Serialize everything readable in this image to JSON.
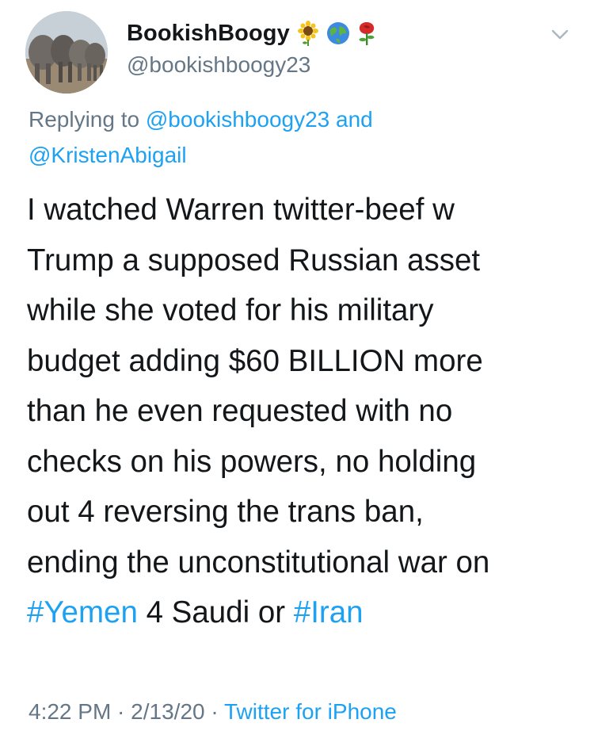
{
  "tweet": {
    "author": {
      "display_name": "BookishBoogy",
      "handle": "@bookishboogy23",
      "name_emojis": [
        "sunflower-emoji",
        "globe-emoji",
        "rose-emoji"
      ]
    },
    "reply": {
      "prefix": "Replying to",
      "user1": "@bookishboogy23",
      "and": "and",
      "user2": "@KristenAbigail"
    },
    "text_lines": [
      "I watched Warren twitter-beef w",
      "Trump a supposed Russian asset",
      "while she voted for his military",
      "budget adding $60 BILLION more",
      "than he even requested with no",
      "checks on his powers, no holding",
      "out 4 reversing the trans ban,",
      "ending the unconstitutional war on"
    ],
    "last_line": {
      "hashtag1": "#Yemen",
      "middle": " 4 Saudi or ",
      "hashtag2": "#Iran"
    },
    "timestamp": "4:22 PM",
    "separator": " · ",
    "date": "2/13/20",
    "source": "Twitter for iPhone"
  },
  "colors": {
    "link": "#1da1f2",
    "secondary": "#657786",
    "text": "#14171a"
  },
  "icons": {
    "more": "chevron-down-icon"
  }
}
